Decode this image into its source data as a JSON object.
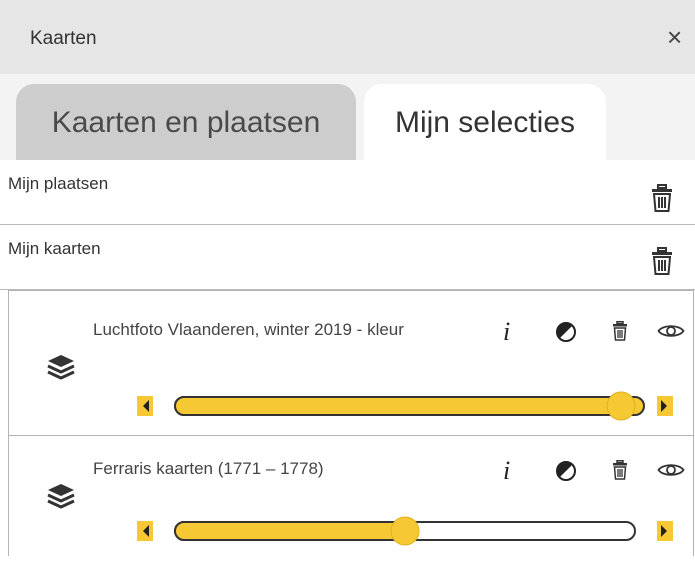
{
  "panel": {
    "title": "Kaarten",
    "close_glyph": "×"
  },
  "tabs": [
    {
      "label": "Kaarten en plaatsen",
      "active": false
    },
    {
      "label": "Mijn selecties",
      "active": true
    }
  ],
  "sections": {
    "places": {
      "label": "Mijn plaatsen",
      "icon": "trash-icon"
    },
    "maps": {
      "label": "Mijn kaarten",
      "icon": "trash-icon"
    }
  },
  "layers": [
    {
      "name": "Luchtfoto Vlaanderen, winter 2019 - kleur",
      "info_glyph": "i",
      "opacity": 1.0
    },
    {
      "name": "Ferraris kaarten (1771 – 1778)",
      "info_glyph": "i",
      "opacity": 0.5
    }
  ],
  "colors": {
    "accent": "#f6c833",
    "accent_stroke": "#c9a100",
    "header_bg": "#e6e6e6",
    "tab_inactive_bg": "#cdcdcd",
    "text": "#333333"
  }
}
